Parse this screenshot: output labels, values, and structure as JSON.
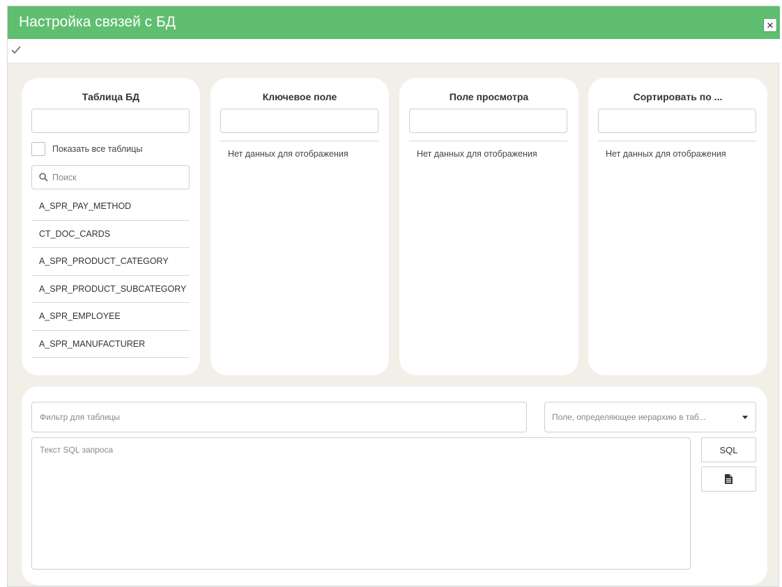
{
  "window": {
    "title": "Настройка связей с БД"
  },
  "toolbar": {
    "confirm_icon": "check-icon"
  },
  "columns": {
    "table": {
      "header": "Таблица БД",
      "show_all_label": "Показать все таблицы",
      "search_placeholder": "Поиск",
      "items": [
        "A_SPR_PAY_METHOD",
        "CT_DOC_CARDS",
        "A_SPR_PRODUCT_CATEGORY",
        "A_SPR_PRODUCT_SUBCATEGORY",
        "A_SPR_EMPLOYEE",
        "A_SPR_MANUFACTURER"
      ]
    },
    "key_field": {
      "header": "Ключевое поле",
      "empty_text": "Нет данных для отображения"
    },
    "view_field": {
      "header": "Поле просмотра",
      "empty_text": "Нет данных для отображения"
    },
    "sort_field": {
      "header": "Сортировать по ...",
      "empty_text": "Нет данных для отображения"
    }
  },
  "bottom": {
    "filter_placeholder": "Фильтр для таблицы",
    "hierarchy_placeholder": "Поле, определяющее иерархию в таб...",
    "sql_placeholder": "Текст SQL запроса",
    "sql_button_label": "SQL",
    "doc_button_icon": "document-icon"
  },
  "colors": {
    "titlebar": "#5fbe6f",
    "background": "#f1efe8"
  }
}
